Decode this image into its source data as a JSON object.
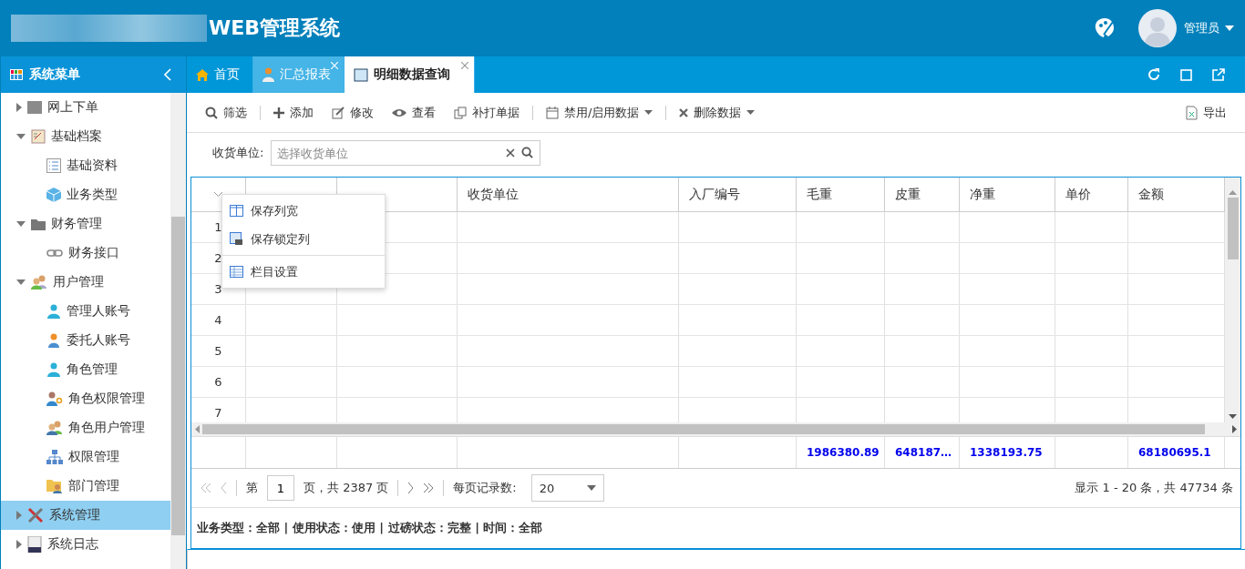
{
  "header": {
    "title": "WEB管理系统",
    "user": "管理员"
  },
  "sidebar": {
    "title": "系统菜单",
    "items": [
      {
        "label": "网上下单",
        "expanded": false,
        "selected": false
      },
      {
        "label": "基础档案",
        "expanded": true,
        "selected": false,
        "children": [
          {
            "label": "基础资料",
            "selected": false
          },
          {
            "label": "业务类型",
            "selected": false
          }
        ]
      },
      {
        "label": "财务管理",
        "expanded": true,
        "selected": false,
        "children": [
          {
            "label": "财务接口",
            "selected": false
          }
        ]
      },
      {
        "label": "用户管理",
        "expanded": true,
        "selected": false,
        "children": [
          {
            "label": "管理人账号",
            "selected": false
          },
          {
            "label": "委托人账号",
            "selected": false
          },
          {
            "label": "角色管理",
            "selected": false
          },
          {
            "label": "角色权限管理",
            "selected": false
          },
          {
            "label": "角色用户管理",
            "selected": false
          },
          {
            "label": "权限管理",
            "selected": false
          },
          {
            "label": "部门管理",
            "selected": false
          }
        ]
      },
      {
        "label": "系统管理",
        "expanded": false,
        "selected": true
      },
      {
        "label": "系统日志",
        "expanded": false,
        "selected": false
      }
    ]
  },
  "tabs": [
    {
      "label": "首页",
      "selected": false,
      "closable": false
    },
    {
      "label": "汇总报表",
      "selected": false,
      "closable": true
    },
    {
      "label": "明细数据查询",
      "selected": true,
      "closable": true
    }
  ],
  "toolbar": [
    {
      "label": "筛选",
      "dropdown": false
    },
    {
      "label": "添加",
      "dropdown": false
    },
    {
      "label": "修改",
      "dropdown": false
    },
    {
      "label": "查看",
      "dropdown": false
    },
    {
      "label": "补打单据",
      "dropdown": false
    },
    {
      "label": "禁用/启用数据",
      "dropdown": true
    },
    {
      "label": "删除数据",
      "dropdown": true
    }
  ],
  "export": "导出",
  "filter": {
    "label": "收货单位:",
    "placeholder": "选择收货单位"
  },
  "table": {
    "columns": [
      {},
      {},
      {
        "label": "收货单位"
      },
      {
        "label": "入厂编号"
      },
      {
        "label": "毛重",
        "total": "1986380.89"
      },
      {
        "label": "皮重",
        "total": "648187…"
      },
      {
        "label": "净重",
        "total": "1338193.75"
      },
      {
        "label": "单价"
      },
      {
        "label": "金额",
        "total": "68180695.1"
      }
    ],
    "row_numbers": [
      "1",
      "2",
      "3",
      "4",
      "5",
      "6",
      "7"
    ]
  },
  "context_menu": [
    "保存列宽",
    "保存锁定列",
    "栏目设置"
  ],
  "pagination": {
    "page_prefix": "第",
    "page": "1",
    "page_suffix": "页，共 2387 页",
    "per_page_label": "每页记录数:",
    "per_page": "20",
    "summary": "显示 1 - 20 条，共 47734 条"
  },
  "status": "业务类型：全部 | 使用状态：使用 | 过磅状态：完整 | 时间：全部"
}
